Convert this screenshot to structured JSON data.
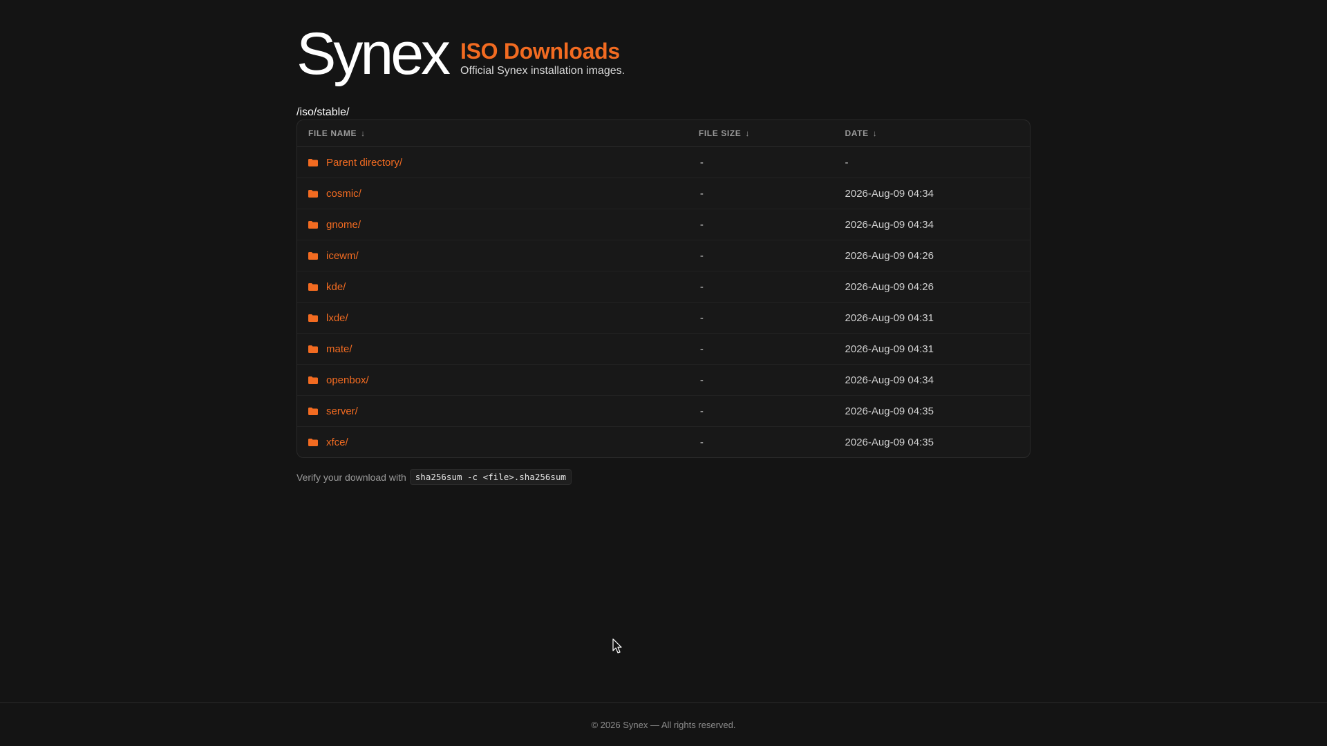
{
  "brand": {
    "logo_text": "Synex",
    "title": "ISO Downloads",
    "subtitle": "Official Synex installation images."
  },
  "path": "/iso/stable/",
  "table": {
    "headers": {
      "name": "FILE NAME",
      "size": "FILE SIZE",
      "date": "DATE"
    },
    "sort_icon": "arrow-down-icon",
    "rows": [
      {
        "name": "Parent directory/",
        "size": "-",
        "date": "-",
        "icon": "folder-icon"
      },
      {
        "name": "cosmic/",
        "size": "-",
        "date": "2026-Aug-09 04:34",
        "icon": "folder-icon"
      },
      {
        "name": "gnome/",
        "size": "-",
        "date": "2026-Aug-09 04:34",
        "icon": "folder-icon"
      },
      {
        "name": "icewm/",
        "size": "-",
        "date": "2026-Aug-09 04:26",
        "icon": "folder-icon"
      },
      {
        "name": "kde/",
        "size": "-",
        "date": "2026-Aug-09 04:26",
        "icon": "folder-icon"
      },
      {
        "name": "lxde/",
        "size": "-",
        "date": "2026-Aug-09 04:31",
        "icon": "folder-icon"
      },
      {
        "name": "mate/",
        "size": "-",
        "date": "2026-Aug-09 04:31",
        "icon": "folder-icon"
      },
      {
        "name": "openbox/",
        "size": "-",
        "date": "2026-Aug-09 04:34",
        "icon": "folder-icon"
      },
      {
        "name": "server/",
        "size": "-",
        "date": "2026-Aug-09 04:35",
        "icon": "folder-icon"
      },
      {
        "name": "xfce/",
        "size": "-",
        "date": "2026-Aug-09 04:35",
        "icon": "folder-icon"
      }
    ]
  },
  "verify": {
    "text": "Verify your download with",
    "command": "sha256sum -c <file>.sha256sum"
  },
  "footer": {
    "text": "© 2026 Synex — All rights reserved."
  },
  "colors": {
    "accent": "#f26b21",
    "background": "#141414",
    "table_background": "#181818",
    "border": "#2a2a2a"
  }
}
